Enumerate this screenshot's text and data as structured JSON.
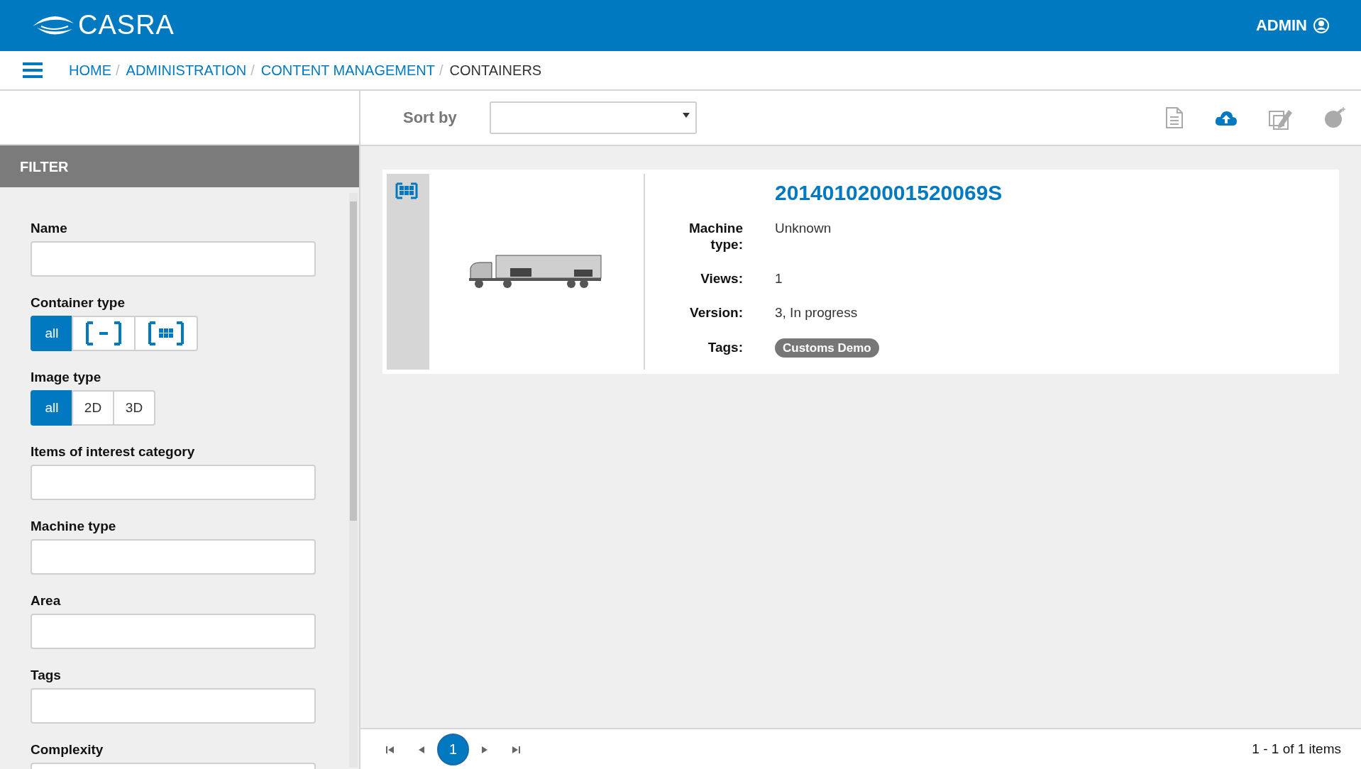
{
  "header": {
    "logo": "CASRA",
    "user": "ADMIN"
  },
  "breadcrumb": [
    {
      "label": "HOME",
      "current": false,
      "separator": "/"
    },
    {
      "label": "ADMINISTRATION",
      "current": false,
      "separator": "/"
    },
    {
      "label": "CONTENT MANAGEMENT",
      "current": false,
      "separator": "/"
    },
    {
      "label": "CONTAINERS",
      "current": true
    }
  ],
  "toolbar": {
    "sort_label": "Sort by",
    "actions": [
      {
        "kind": "document",
        "disabled": true
      },
      {
        "kind": "upload",
        "disabled": false
      },
      {
        "kind": "edit",
        "disabled": true
      },
      {
        "kind": "bomb",
        "disabled": true
      }
    ]
  },
  "filter": {
    "title": "FILTER",
    "fields": [
      {
        "kind": "text",
        "label": "Name"
      },
      {
        "kind": "toggle",
        "label": "Container type",
        "options": [
          {
            "kind": "text",
            "label": "all",
            "selected": true
          },
          {
            "kind": "single",
            "selected": false
          },
          {
            "kind": "multi",
            "selected": false
          }
        ]
      },
      {
        "kind": "toggle",
        "label": "Image type",
        "options": [
          {
            "kind": "text",
            "label": "all",
            "selected": true
          },
          {
            "kind": "text",
            "label": "2D",
            "selected": false
          },
          {
            "kind": "text",
            "label": "3D",
            "selected": false
          }
        ]
      },
      {
        "kind": "text",
        "label": "Items of interest category"
      },
      {
        "kind": "text",
        "label": "Machine type"
      },
      {
        "kind": "text",
        "label": "Area"
      },
      {
        "kind": "text",
        "label": "Tags"
      },
      {
        "kind": "text",
        "label": "Complexity"
      }
    ]
  },
  "containers": [
    {
      "kind": "multi",
      "title": "201401020001520069S",
      "details": [
        {
          "label": "Machine type:",
          "value": "Unknown"
        },
        {
          "label": "Views:",
          "value": "1"
        },
        {
          "label": "Version:",
          "value": "3, In progress"
        }
      ],
      "tags_label": "Tags:",
      "tags": [
        "Customs Demo"
      ]
    }
  ],
  "pagination": {
    "pages": [
      {
        "label": "1",
        "selected": true
      }
    ],
    "summary": "1 - 1 of 1 items"
  }
}
